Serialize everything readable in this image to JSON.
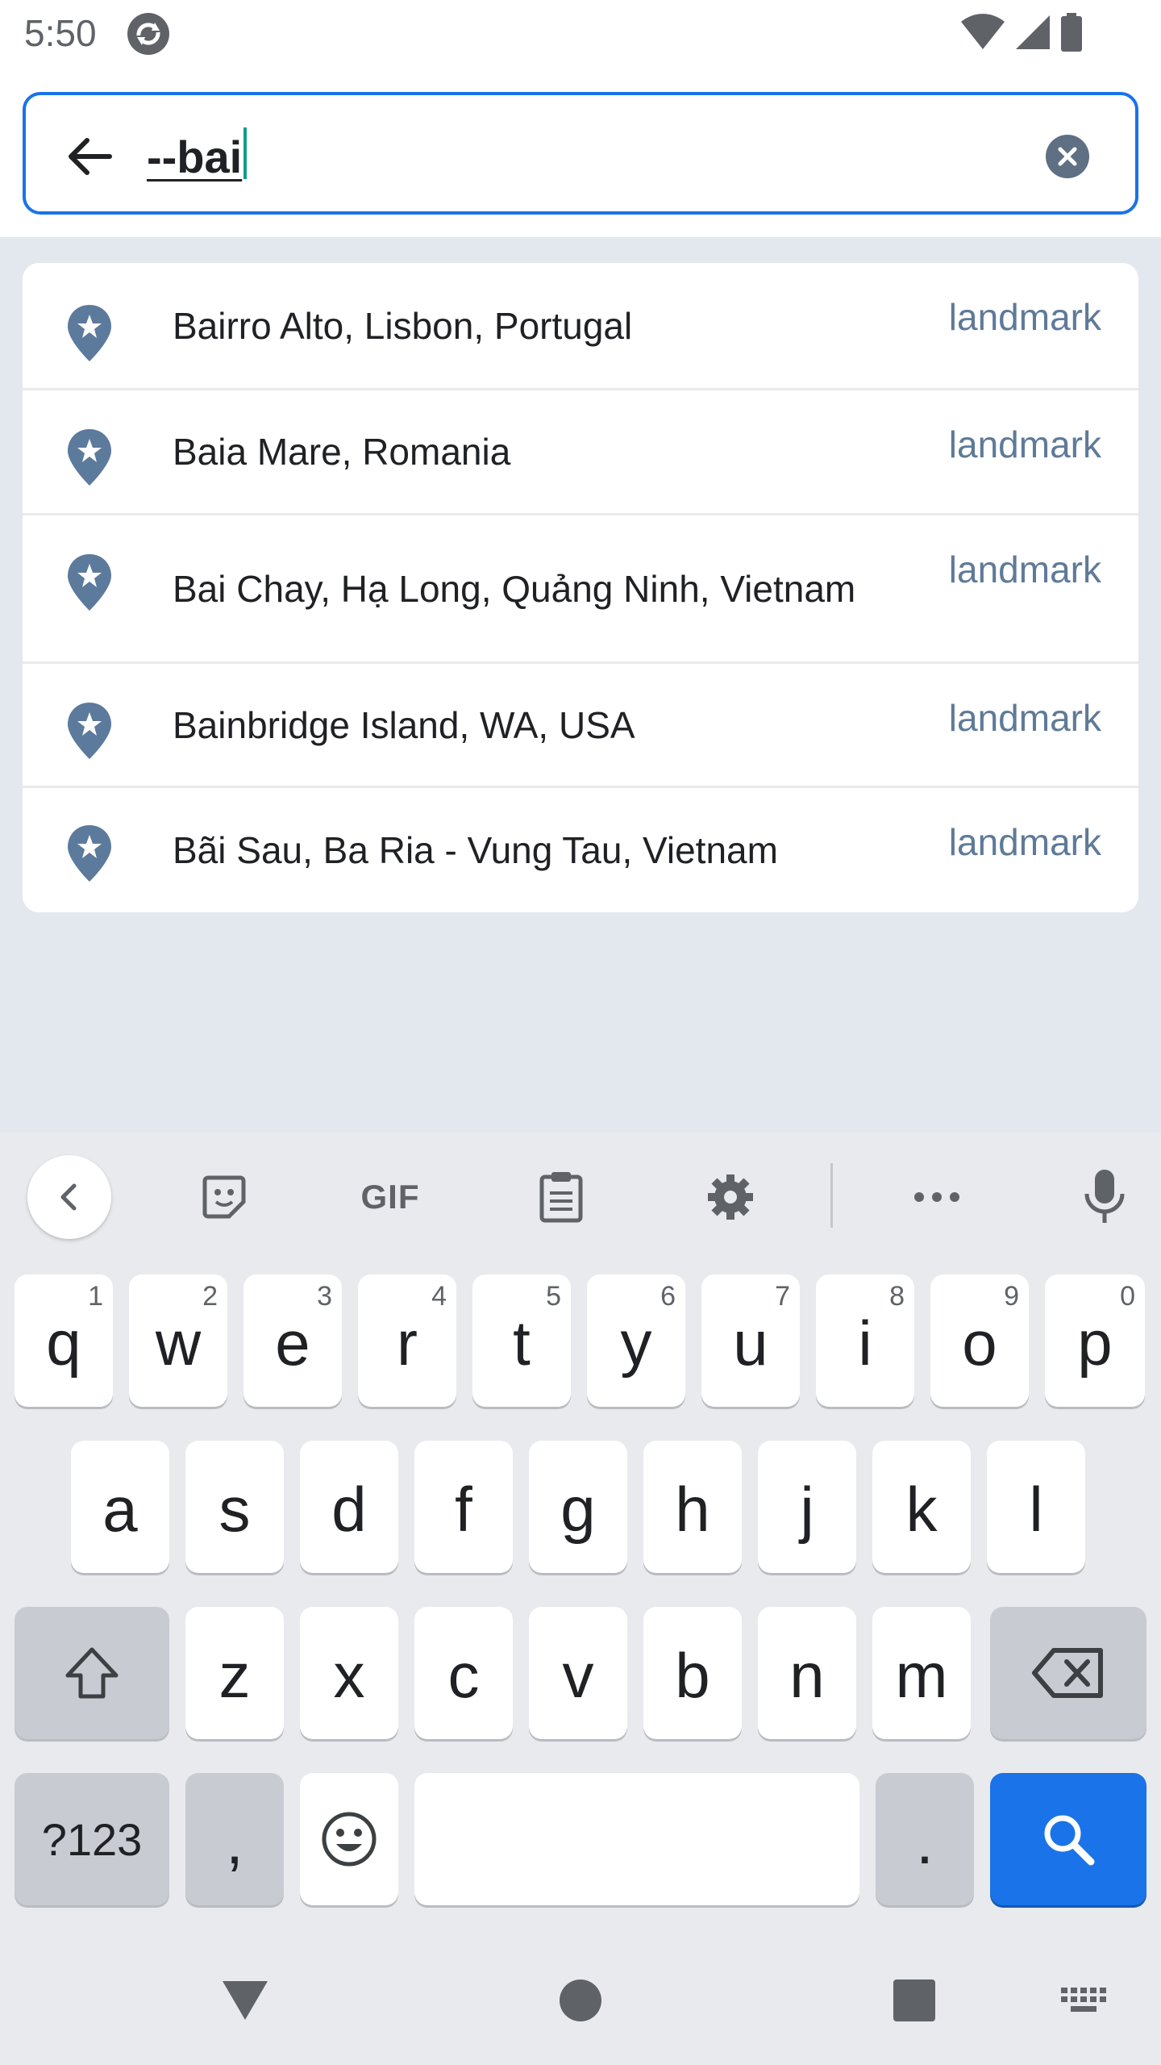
{
  "status_bar": {
    "time": "5:50"
  },
  "search": {
    "query": "--bai"
  },
  "results": [
    {
      "name": "Bairro Alto, Lisbon, Portugal",
      "type": "landmark"
    },
    {
      "name": "Baia Mare, Romania",
      "type": "landmark"
    },
    {
      "name": "Bai Chay, Hạ Long, Quảng Ninh, Vietnam",
      "type": "landmark"
    },
    {
      "name": "Bainbridge Island, WA, USA",
      "type": "landmark"
    },
    {
      "name": "Bãi Sau, Ba Ria - Vung Tau, Vietnam",
      "type": "landmark"
    }
  ],
  "keyboard": {
    "toolbar": {
      "gif": "GIF"
    },
    "row1": [
      {
        "key": "q",
        "hint": "1"
      },
      {
        "key": "w",
        "hint": "2"
      },
      {
        "key": "e",
        "hint": "3"
      },
      {
        "key": "r",
        "hint": "4"
      },
      {
        "key": "t",
        "hint": "5"
      },
      {
        "key": "y",
        "hint": "6"
      },
      {
        "key": "u",
        "hint": "7"
      },
      {
        "key": "i",
        "hint": "8"
      },
      {
        "key": "o",
        "hint": "9"
      },
      {
        "key": "p",
        "hint": "0"
      }
    ],
    "row2": [
      "a",
      "s",
      "d",
      "f",
      "g",
      "h",
      "j",
      "k",
      "l"
    ],
    "row3": [
      "z",
      "x",
      "c",
      "v",
      "b",
      "n",
      "m"
    ],
    "symbols_key": "?123",
    "comma_key": ",",
    "period_key": "."
  },
  "colors": {
    "accent": "#1a73e8",
    "pin": "#5c7a9c",
    "type_label": "#5f7a99",
    "results_bg": "#e3e8ef"
  },
  "icons": {
    "back": "arrow-left-icon",
    "clear": "clear-circle-icon",
    "pin": "star-pin-icon",
    "search": "search-icon",
    "mic": "microphone-icon",
    "settings": "gear-icon"
  }
}
